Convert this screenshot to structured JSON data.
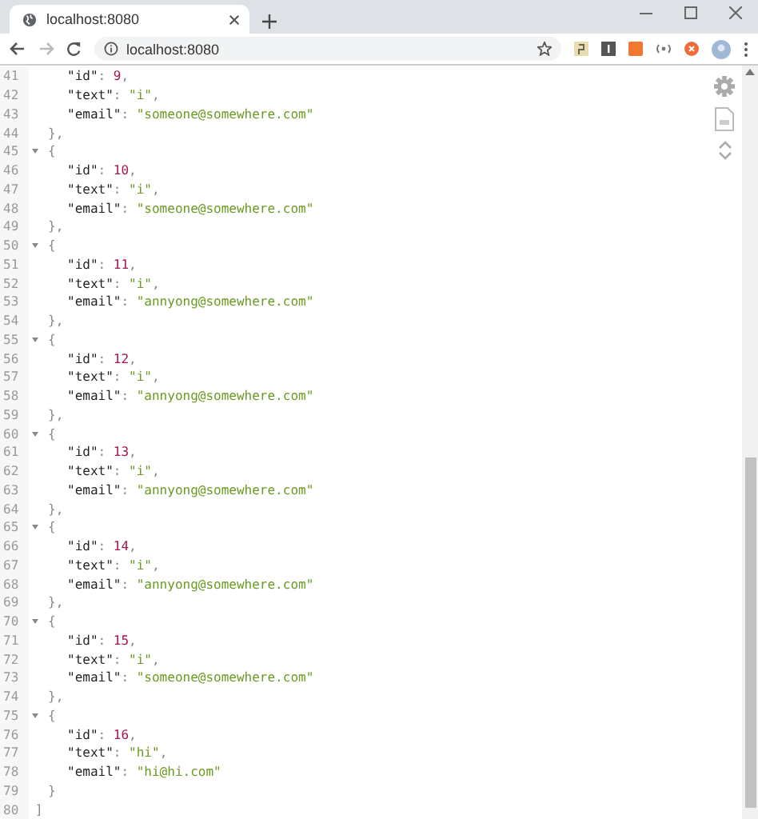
{
  "tab": {
    "title": "localhost:8080",
    "selected": true
  },
  "address_bar": {
    "url": "localhost:8080"
  },
  "lines": [
    {
      "number": "41",
      "fold": false,
      "kind": "field",
      "tokens": [
        {
          "kind": "key",
          "text": "\"id\""
        },
        {
          "kind": "punct",
          "text": ": "
        },
        {
          "kind": "number",
          "text": "9"
        },
        {
          "kind": "punct",
          "text": ","
        }
      ]
    },
    {
      "number": "42",
      "fold": false,
      "kind": "field",
      "tokens": [
        {
          "kind": "key",
          "text": "\"text\""
        },
        {
          "kind": "punct",
          "text": ": "
        },
        {
          "kind": "string",
          "text": "\"i\""
        },
        {
          "kind": "punct",
          "text": ","
        }
      ]
    },
    {
      "number": "43",
      "fold": false,
      "kind": "field",
      "tokens": [
        {
          "kind": "key",
          "text": "\"email\""
        },
        {
          "kind": "punct",
          "text": ": "
        },
        {
          "kind": "string",
          "text": "\"someone@somewhere.com\""
        }
      ]
    },
    {
      "number": "44",
      "fold": false,
      "kind": "brace",
      "tokens": [
        {
          "kind": "punct",
          "text": "},"
        }
      ]
    },
    {
      "number": "45",
      "fold": true,
      "kind": "brace",
      "tokens": [
        {
          "kind": "punct",
          "text": "{"
        }
      ]
    },
    {
      "number": "46",
      "fold": false,
      "kind": "field",
      "tokens": [
        {
          "kind": "key",
          "text": "\"id\""
        },
        {
          "kind": "punct",
          "text": ": "
        },
        {
          "kind": "number",
          "text": "10"
        },
        {
          "kind": "punct",
          "text": ","
        }
      ]
    },
    {
      "number": "47",
      "fold": false,
      "kind": "field",
      "tokens": [
        {
          "kind": "key",
          "text": "\"text\""
        },
        {
          "kind": "punct",
          "text": ": "
        },
        {
          "kind": "string",
          "text": "\"i\""
        },
        {
          "kind": "punct",
          "text": ","
        }
      ]
    },
    {
      "number": "48",
      "fold": false,
      "kind": "field",
      "tokens": [
        {
          "kind": "key",
          "text": "\"email\""
        },
        {
          "kind": "punct",
          "text": ": "
        },
        {
          "kind": "string",
          "text": "\"someone@somewhere.com\""
        }
      ]
    },
    {
      "number": "49",
      "fold": false,
      "kind": "brace",
      "tokens": [
        {
          "kind": "punct",
          "text": "},"
        }
      ]
    },
    {
      "number": "50",
      "fold": true,
      "kind": "brace",
      "tokens": [
        {
          "kind": "punct",
          "text": "{"
        }
      ]
    },
    {
      "number": "51",
      "fold": false,
      "kind": "field",
      "tokens": [
        {
          "kind": "key",
          "text": "\"id\""
        },
        {
          "kind": "punct",
          "text": ": "
        },
        {
          "kind": "number",
          "text": "11"
        },
        {
          "kind": "punct",
          "text": ","
        }
      ]
    },
    {
      "number": "52",
      "fold": false,
      "kind": "field",
      "tokens": [
        {
          "kind": "key",
          "text": "\"text\""
        },
        {
          "kind": "punct",
          "text": ": "
        },
        {
          "kind": "string",
          "text": "\"i\""
        },
        {
          "kind": "punct",
          "text": ","
        }
      ]
    },
    {
      "number": "53",
      "fold": false,
      "kind": "field",
      "tokens": [
        {
          "kind": "key",
          "text": "\"email\""
        },
        {
          "kind": "punct",
          "text": ": "
        },
        {
          "kind": "string",
          "text": "\"annyong@somewhere.com\""
        }
      ]
    },
    {
      "number": "54",
      "fold": false,
      "kind": "brace",
      "tokens": [
        {
          "kind": "punct",
          "text": "},"
        }
      ]
    },
    {
      "number": "55",
      "fold": true,
      "kind": "brace",
      "tokens": [
        {
          "kind": "punct",
          "text": "{"
        }
      ]
    },
    {
      "number": "56",
      "fold": false,
      "kind": "field",
      "tokens": [
        {
          "kind": "key",
          "text": "\"id\""
        },
        {
          "kind": "punct",
          "text": ": "
        },
        {
          "kind": "number",
          "text": "12"
        },
        {
          "kind": "punct",
          "text": ","
        }
      ]
    },
    {
      "number": "57",
      "fold": false,
      "kind": "field",
      "tokens": [
        {
          "kind": "key",
          "text": "\"text\""
        },
        {
          "kind": "punct",
          "text": ": "
        },
        {
          "kind": "string",
          "text": "\"i\""
        },
        {
          "kind": "punct",
          "text": ","
        }
      ]
    },
    {
      "number": "58",
      "fold": false,
      "kind": "field",
      "tokens": [
        {
          "kind": "key",
          "text": "\"email\""
        },
        {
          "kind": "punct",
          "text": ": "
        },
        {
          "kind": "string",
          "text": "\"annyong@somewhere.com\""
        }
      ]
    },
    {
      "number": "59",
      "fold": false,
      "kind": "brace",
      "tokens": [
        {
          "kind": "punct",
          "text": "},"
        }
      ]
    },
    {
      "number": "60",
      "fold": true,
      "kind": "brace",
      "tokens": [
        {
          "kind": "punct",
          "text": "{"
        }
      ]
    },
    {
      "number": "61",
      "fold": false,
      "kind": "field",
      "tokens": [
        {
          "kind": "key",
          "text": "\"id\""
        },
        {
          "kind": "punct",
          "text": ": "
        },
        {
          "kind": "number",
          "text": "13"
        },
        {
          "kind": "punct",
          "text": ","
        }
      ]
    },
    {
      "number": "62",
      "fold": false,
      "kind": "field",
      "tokens": [
        {
          "kind": "key",
          "text": "\"text\""
        },
        {
          "kind": "punct",
          "text": ": "
        },
        {
          "kind": "string",
          "text": "\"i\""
        },
        {
          "kind": "punct",
          "text": ","
        }
      ]
    },
    {
      "number": "63",
      "fold": false,
      "kind": "field",
      "tokens": [
        {
          "kind": "key",
          "text": "\"email\""
        },
        {
          "kind": "punct",
          "text": ": "
        },
        {
          "kind": "string",
          "text": "\"annyong@somewhere.com\""
        }
      ]
    },
    {
      "number": "64",
      "fold": false,
      "kind": "brace",
      "tokens": [
        {
          "kind": "punct",
          "text": "},"
        }
      ]
    },
    {
      "number": "65",
      "fold": true,
      "kind": "brace",
      "tokens": [
        {
          "kind": "punct",
          "text": "{"
        }
      ]
    },
    {
      "number": "66",
      "fold": false,
      "kind": "field",
      "tokens": [
        {
          "kind": "key",
          "text": "\"id\""
        },
        {
          "kind": "punct",
          "text": ": "
        },
        {
          "kind": "number",
          "text": "14"
        },
        {
          "kind": "punct",
          "text": ","
        }
      ]
    },
    {
      "number": "67",
      "fold": false,
      "kind": "field",
      "tokens": [
        {
          "kind": "key",
          "text": "\"text\""
        },
        {
          "kind": "punct",
          "text": ": "
        },
        {
          "kind": "string",
          "text": "\"i\""
        },
        {
          "kind": "punct",
          "text": ","
        }
      ]
    },
    {
      "number": "68",
      "fold": false,
      "kind": "field",
      "tokens": [
        {
          "kind": "key",
          "text": "\"email\""
        },
        {
          "kind": "punct",
          "text": ": "
        },
        {
          "kind": "string",
          "text": "\"annyong@somewhere.com\""
        }
      ]
    },
    {
      "number": "69",
      "fold": false,
      "kind": "brace",
      "tokens": [
        {
          "kind": "punct",
          "text": "},"
        }
      ]
    },
    {
      "number": "70",
      "fold": true,
      "kind": "brace",
      "tokens": [
        {
          "kind": "punct",
          "text": "{"
        }
      ]
    },
    {
      "number": "71",
      "fold": false,
      "kind": "field",
      "tokens": [
        {
          "kind": "key",
          "text": "\"id\""
        },
        {
          "kind": "punct",
          "text": ": "
        },
        {
          "kind": "number",
          "text": "15"
        },
        {
          "kind": "punct",
          "text": ","
        }
      ]
    },
    {
      "number": "72",
      "fold": false,
      "kind": "field",
      "tokens": [
        {
          "kind": "key",
          "text": "\"text\""
        },
        {
          "kind": "punct",
          "text": ": "
        },
        {
          "kind": "string",
          "text": "\"i\""
        },
        {
          "kind": "punct",
          "text": ","
        }
      ]
    },
    {
      "number": "73",
      "fold": false,
      "kind": "field",
      "tokens": [
        {
          "kind": "key",
          "text": "\"email\""
        },
        {
          "kind": "punct",
          "text": ": "
        },
        {
          "kind": "string",
          "text": "\"someone@somewhere.com\""
        }
      ]
    },
    {
      "number": "74",
      "fold": false,
      "kind": "brace",
      "tokens": [
        {
          "kind": "punct",
          "text": "},"
        }
      ]
    },
    {
      "number": "75",
      "fold": true,
      "kind": "brace",
      "tokens": [
        {
          "kind": "punct",
          "text": "{"
        }
      ]
    },
    {
      "number": "76",
      "fold": false,
      "kind": "field",
      "tokens": [
        {
          "kind": "key",
          "text": "\"id\""
        },
        {
          "kind": "punct",
          "text": ": "
        },
        {
          "kind": "number",
          "text": "16"
        },
        {
          "kind": "punct",
          "text": ","
        }
      ]
    },
    {
      "number": "77",
      "fold": false,
      "kind": "field",
      "tokens": [
        {
          "kind": "key",
          "text": "\"text\""
        },
        {
          "kind": "punct",
          "text": ": "
        },
        {
          "kind": "string",
          "text": "\"hi\""
        },
        {
          "kind": "punct",
          "text": ","
        }
      ]
    },
    {
      "number": "78",
      "fold": false,
      "kind": "field",
      "tokens": [
        {
          "kind": "key",
          "text": "\"email\""
        },
        {
          "kind": "punct",
          "text": ": "
        },
        {
          "kind": "string",
          "text": "\"hi@hi.com\""
        }
      ]
    },
    {
      "number": "79",
      "fold": false,
      "kind": "brace",
      "tokens": [
        {
          "kind": "punct",
          "text": "}"
        }
      ]
    },
    {
      "number": "80",
      "fold": false,
      "kind": "root",
      "tokens": [
        {
          "kind": "punct",
          "text": "]"
        }
      ]
    }
  ]
}
